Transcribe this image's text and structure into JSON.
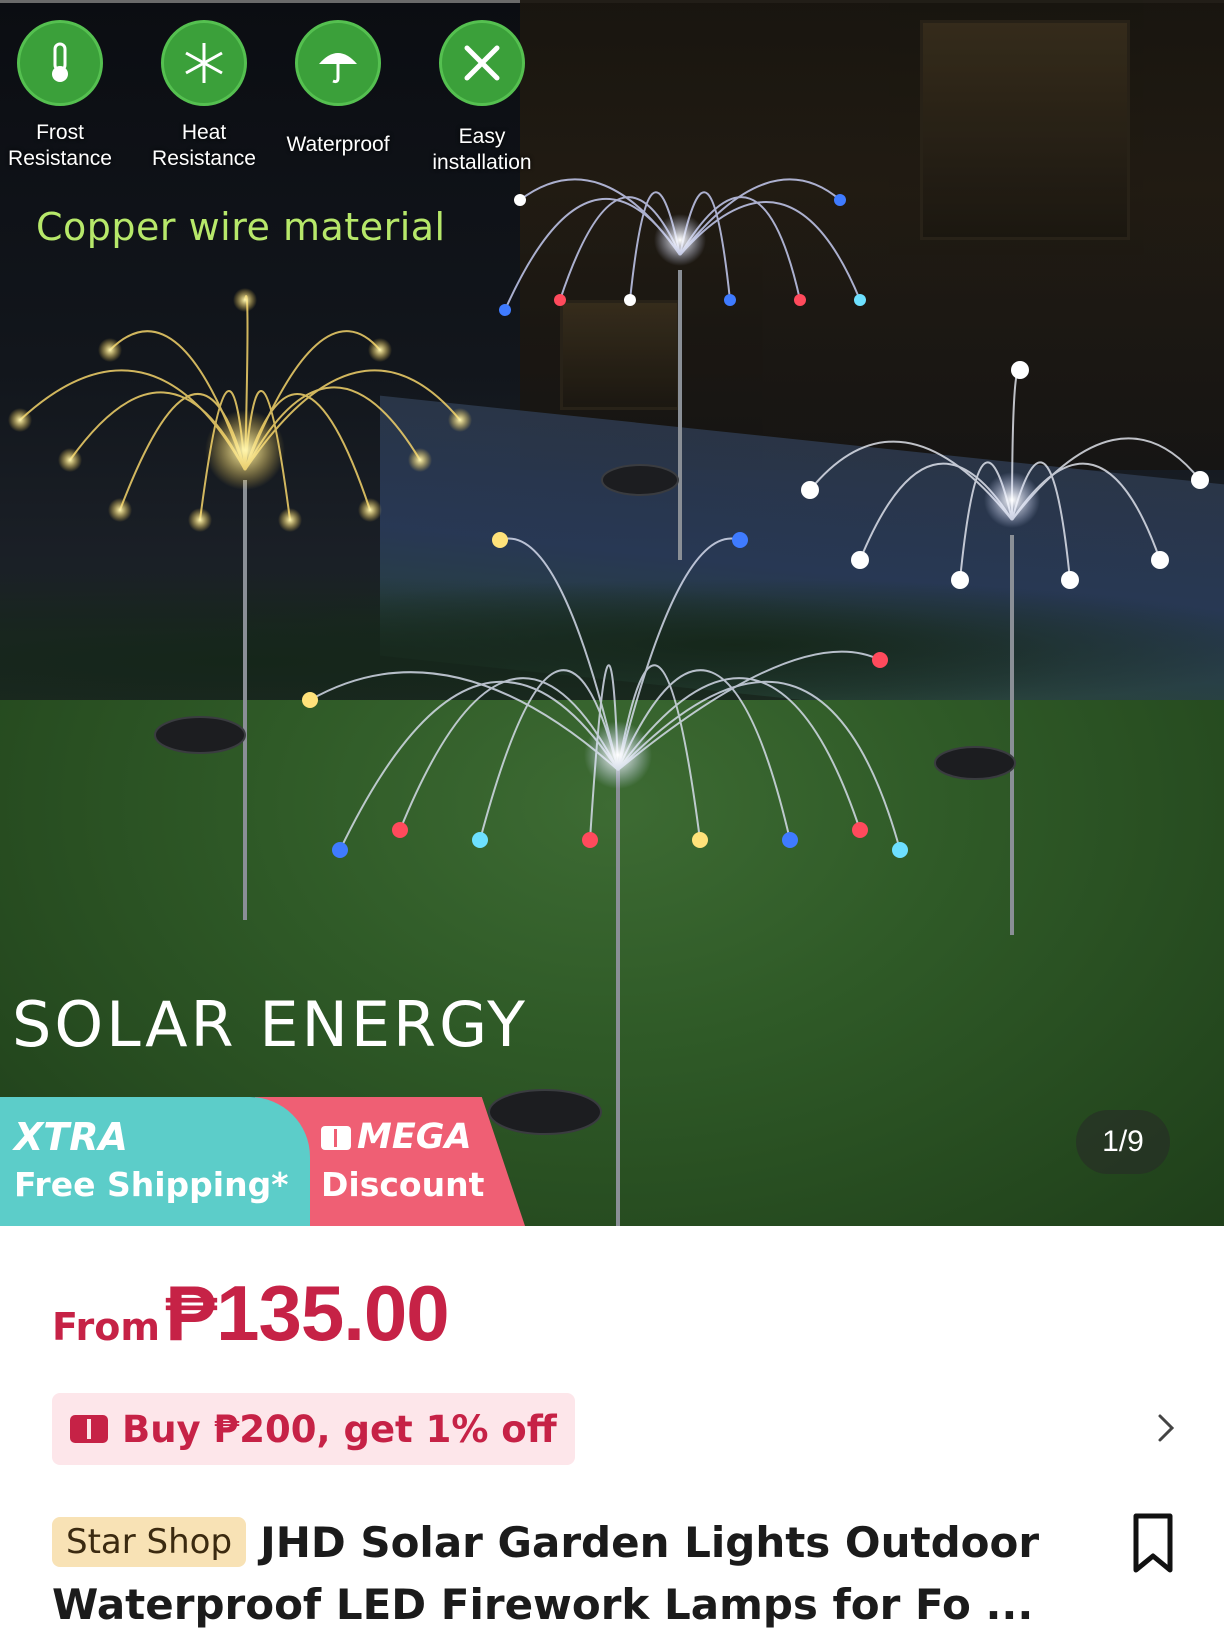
{
  "hero": {
    "features": [
      {
        "icon": "thermometer-icon",
        "label_line1": "Frost",
        "label_line2": "Resistance"
      },
      {
        "icon": "snowflake-icon",
        "label_line1": "Heat",
        "label_line2": "Resistance"
      },
      {
        "icon": "umbrella-icon",
        "label_line1": "Waterproof",
        "label_line2": ""
      },
      {
        "icon": "tools-icon",
        "label_line1": "Easy",
        "label_line2": "installation"
      }
    ],
    "tagline": "Copper wire material",
    "headline": "SOLAR ENERGY",
    "badge_xtra_line1": "XTRA",
    "badge_xtra_line2": "Free Shipping*",
    "badge_mega_line1": "MEGA",
    "badge_mega_line2": "Discount",
    "image_counter": "1/9"
  },
  "product": {
    "price_prefix": "From",
    "price": "₱135.00",
    "promo_text": "Buy ₱200, get 1% off",
    "shop_tag": "Star Shop",
    "title": "JHD Solar Garden Lights Outdoor Waterproof LED Firework Lamps for Fo ..."
  },
  "colors": {
    "accent_red": "#c62246",
    "feature_green": "#3ba03a",
    "xtra_teal": "#5ccdc9",
    "mega_pink": "#ef5f74",
    "shop_tag_bg": "#f8e2b5"
  }
}
